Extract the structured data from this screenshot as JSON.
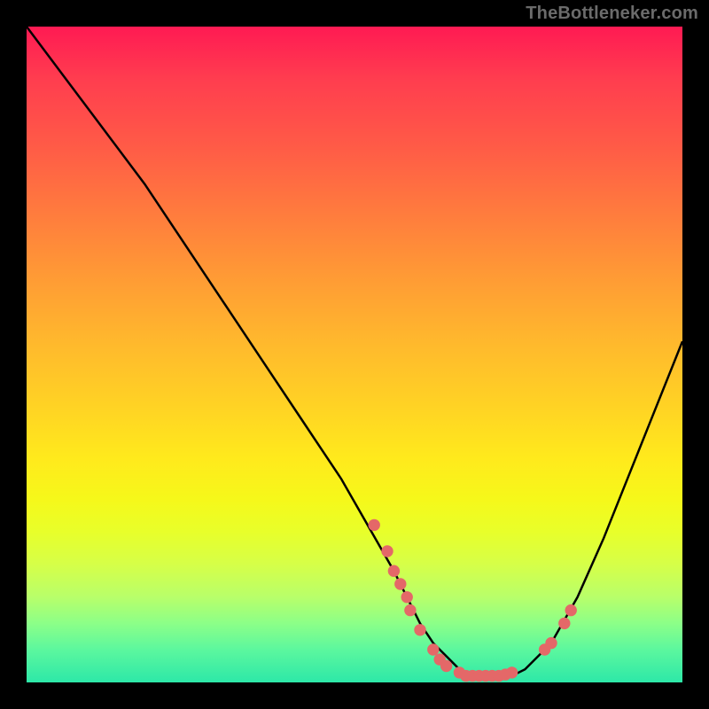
{
  "watermark": "TheBottleneker.com",
  "chart_data": {
    "type": "line",
    "title": "",
    "xlabel": "",
    "ylabel": "",
    "xlim": [
      0,
      100
    ],
    "ylim": [
      0,
      100
    ],
    "grid": false,
    "legend": false,
    "series": [
      {
        "name": "curve",
        "color": "#000000",
        "x": [
          0,
          6,
          12,
          18,
          24,
          30,
          36,
          42,
          48,
          52,
          56,
          58,
          60,
          62,
          64,
          66,
          68,
          70,
          72,
          74,
          76,
          80,
          84,
          88,
          92,
          96,
          100
        ],
        "y": [
          100,
          92,
          84,
          76,
          67,
          58,
          49,
          40,
          31,
          24,
          17,
          13,
          9,
          6,
          4,
          2,
          1,
          1,
          1,
          1,
          2,
          6,
          13,
          22,
          32,
          42,
          52
        ]
      }
    ],
    "markers": {
      "color": "#e46868",
      "radius_pct": 0.9,
      "points_xy": [
        [
          53,
          24
        ],
        [
          55,
          20
        ],
        [
          56,
          17
        ],
        [
          57,
          15
        ],
        [
          58,
          13
        ],
        [
          58.5,
          11
        ],
        [
          60,
          8
        ],
        [
          62,
          5
        ],
        [
          63,
          3.5
        ],
        [
          64,
          2.5
        ],
        [
          66,
          1.5
        ],
        [
          67,
          1
        ],
        [
          68,
          1
        ],
        [
          69,
          1
        ],
        [
          70,
          1
        ],
        [
          71,
          1
        ],
        [
          72,
          1
        ],
        [
          73,
          1.2
        ],
        [
          74,
          1.5
        ],
        [
          79,
          5
        ],
        [
          80,
          6
        ],
        [
          82,
          9
        ],
        [
          83,
          11
        ]
      ]
    }
  }
}
